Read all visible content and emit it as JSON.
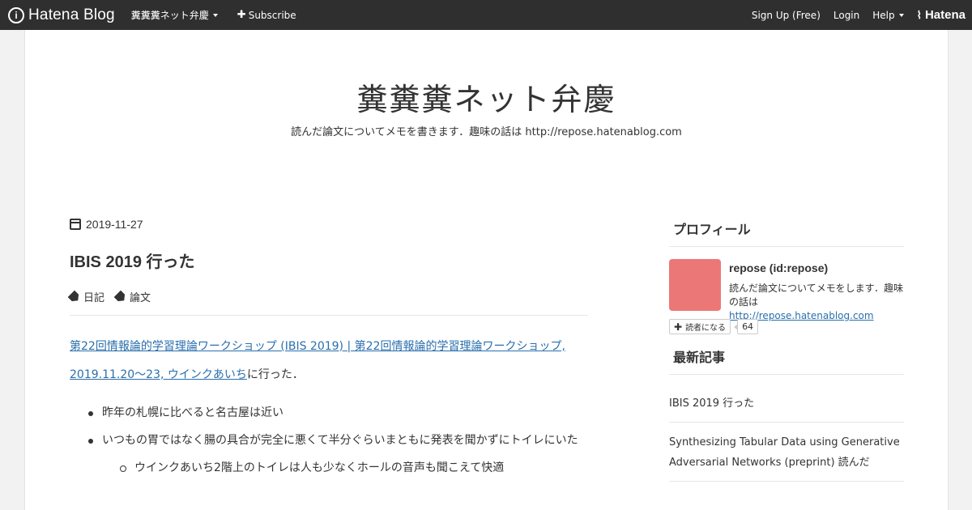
{
  "topbar": {
    "logo_text": "Hatena Blog",
    "logo_letter": "i",
    "blog_menu": "糞糞糞ネット弁慶",
    "subscribe": "Subscribe",
    "signup": "Sign Up (Free)",
    "login": "Login",
    "help": "Help",
    "hatena_brand": "Hatena"
  },
  "header": {
    "title": "糞糞糞ネット弁慶",
    "description": "読んだ論文についてメモを書きます．趣味の話は http://repose.hatenablog.com"
  },
  "article": {
    "date": "2019-11-27",
    "title": "IBIS 2019 行った",
    "categories": [
      "日記",
      "論文"
    ],
    "link_text": "第22回情報論的学習理論ワークショップ (IBIS 2019) | 第22回情報論的学習理論ワークショップ, 2019.11.20〜23, ウインクあいち",
    "after_link": "に行った．",
    "bullets": [
      "昨年の札幌に比べると名古屋は近い",
      "いつもの胃ではなく腸の具合が完全に悪くて半分ぐらいまともに発表を聞かずにトイレにいた"
    ],
    "sub_bullets": [
      "ウインクあいち2階上のトイレは人も少なくホールの音声も聞こえて快適"
    ]
  },
  "sidebar": {
    "profile_title": "プロフィール",
    "profile_name": "repose (id:repose)",
    "profile_desc": "読んだ論文についてメモをします．趣味の話は ",
    "profile_link": "http://repose.hatenablog.com",
    "reader_button": "読者になる",
    "reader_count": "64",
    "recent_title": "最新記事",
    "recent_items": [
      "IBIS 2019 行った",
      "Synthesizing Tabular Data using Generative Adversarial Networks (preprint) 読んだ"
    ]
  },
  "colors": {
    "topbar": "#2f2f2f",
    "link": "#2a6fad",
    "avatar": "#ec7777"
  }
}
